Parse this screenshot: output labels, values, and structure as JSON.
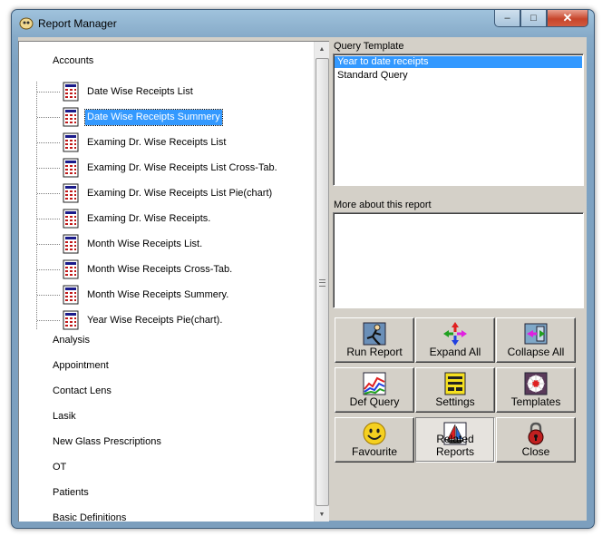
{
  "window": {
    "title": "Report Manager"
  },
  "titlebar_buttons": {
    "minimize": "–",
    "maximize": "□",
    "close": "✕"
  },
  "tree": {
    "groups": [
      "Accounts",
      "Analysis",
      "Appointment",
      "Contact Lens",
      "Lasik",
      "New Glass Prescriptions",
      "OT",
      "Patients",
      "Basic Definitions"
    ],
    "accounts_items": [
      "Date Wise Receipts List",
      "Date Wise Receipts Summery",
      "Examing Dr. Wise Receipts List",
      "Examing Dr. Wise Receipts List Cross-Tab.",
      "Examing Dr. Wise Receipts List Pie(chart)",
      "Examing Dr. Wise Receipts.",
      "Month  Wise Receipts List.",
      "Month Wise Receipts Cross-Tab.",
      "Month Wise Receipts Summery.",
      "Year Wise Receipts Pie(chart)."
    ],
    "selected_item": "Date Wise Receipts Summery"
  },
  "query_template": {
    "label": "Query Template",
    "items": [
      "Year to date receipts",
      "Standard Query"
    ],
    "selected": "Year to date receipts"
  },
  "more_about": {
    "label": "More about this report",
    "text": ""
  },
  "buttons": [
    {
      "label": "Run Report",
      "icon": "run-report-icon"
    },
    {
      "label": "Expand All",
      "icon": "expand-all-icon"
    },
    {
      "label": "Collapse All",
      "icon": "collapse-all-icon"
    },
    {
      "label": "Def Query",
      "icon": "def-query-chart-icon"
    },
    {
      "label": "Settings",
      "icon": "settings-icon"
    },
    {
      "label": "Templates",
      "icon": "templates-icon"
    },
    {
      "label": "Favourite",
      "icon": "smiley-icon"
    },
    {
      "label": "Related Reports",
      "icon": "sailboat-icon"
    },
    {
      "label": "Close",
      "icon": "padlock-icon"
    }
  ],
  "colors": {
    "selection": "#3399ff",
    "face": "#d4d0c8"
  }
}
